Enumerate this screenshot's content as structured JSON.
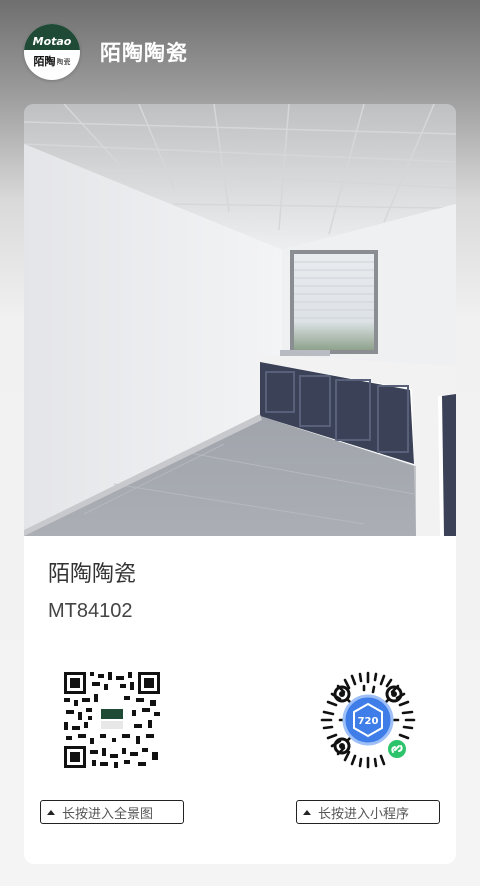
{
  "header": {
    "logo_text_top": "Motao",
    "logo_text_cn": "陌陶",
    "logo_text_small": "陶瓷",
    "title": "陌陶陶瓷"
  },
  "product": {
    "name": "陌陶陶瓷",
    "code": "MT84102"
  },
  "qr": {
    "left_hint": "长按进入全景图",
    "right_hint": "长按进入小程序",
    "right_badge": "720"
  },
  "colors": {
    "brand_green": "#1e4a36",
    "cabinet_navy": "#3b4257",
    "miniapp_blue": "#3f7ee8",
    "wechat_green": "#2cc36b"
  }
}
